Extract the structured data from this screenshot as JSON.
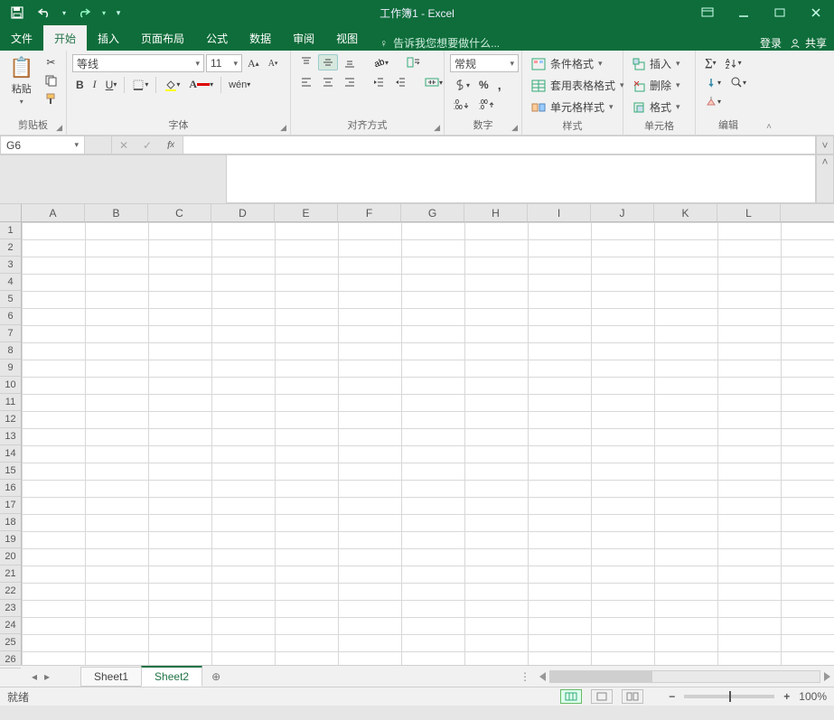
{
  "app": {
    "title": "工作簿1 - Excel"
  },
  "tabs": {
    "file": "文件",
    "home": "开始",
    "insert": "插入",
    "pagelayout": "页面布局",
    "formulas": "公式",
    "data": "数据",
    "review": "审阅",
    "view": "视图",
    "tellme": "告诉我您想要做什么...",
    "login": "登录",
    "share": "共享"
  },
  "ribbon": {
    "clipboard": {
      "paste": "粘贴",
      "label": "剪贴板"
    },
    "font": {
      "name": "等线",
      "size": "11",
      "label": "字体",
      "pinyin": "wén"
    },
    "alignment": {
      "label": "对齐方式"
    },
    "number": {
      "format": "常规",
      "label": "数字"
    },
    "styles": {
      "cond": "条件格式",
      "tbl": "套用表格格式",
      "cell": "单元格样式",
      "label": "样式"
    },
    "cells": {
      "insert": "插入",
      "delete": "删除",
      "format": "格式",
      "label": "单元格"
    },
    "editing": {
      "label": "编辑"
    }
  },
  "namebox": "G6",
  "columns": [
    "A",
    "B",
    "C",
    "D",
    "E",
    "F",
    "G",
    "H",
    "I",
    "J",
    "K",
    "L"
  ],
  "rows": [
    "1",
    "2",
    "3",
    "4",
    "5",
    "6",
    "7",
    "8",
    "9",
    "10",
    "11",
    "12",
    "13",
    "14",
    "15",
    "16",
    "17",
    "18",
    "19",
    "20",
    "21",
    "22",
    "23",
    "24",
    "25",
    "26"
  ],
  "sheets": {
    "s1": "Sheet1",
    "s2": "Sheet2"
  },
  "status": {
    "ready": "就绪",
    "zoom": "100%"
  }
}
